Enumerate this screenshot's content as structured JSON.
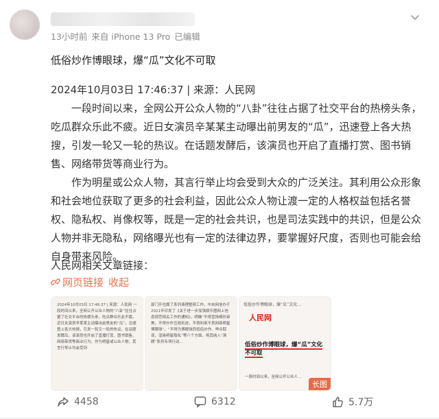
{
  "post": {
    "time": "13小时前",
    "source": "来自 iPhone 13 Pro",
    "edited": "已编辑",
    "title": "低俗炒作博眼球，爆“瓜”文化不可取",
    "date_line": "2024年10月03日 17:46:37 | 来源：人民网",
    "para1": "一段时间以来，全网公开公众人物的“八卦”往往占据了社交平台的热榜头条，吃瓜群众乐此不疲。近日女演员辛某某主动曝出前男友的“瓜”，迅速登上各大热搜，引发一轮又一轮的热议。在话题发酵后，该演员也开启了直播打赏、图书销售、网络带货等商业行为。",
    "para2": "作为明星或公众人物，其言行举止均会受到大众的广泛关注。其利用公众形象和社会地位获取了更多的社会利益，因此公众人物让渡一定的人格权益包括名誉权、隐私权、肖像权等，既是一定的社会共识，也是司法实践中的共识，但是公众人物并非无隐私，网络曝光也有一定的法律边界，要掌握好尺度，否则也可能会给自身带来风险。",
    "related": "人民网相关文章链接：",
    "link_label": "网页链接",
    "collapse_label": "收起"
  },
  "thumbs": {
    "t1_text": "2024年10月03日 17:46:37 | 来源：人民网 一段时间以来，全网公开公众人物的“八卦”往往占据了社交平台的热榜头条，吃瓜群众乐此不疲。近日女演员辛某某主动曝出前男友的“瓜”，迅速登上各大热搜，引发一轮又一轮的热议。在话题发酵后，该演员也开启了直播打赏、图书销售、网络带货等商业行为。作为明星或公众人物，其言行举止均会受到",
    "t2_text": "部门开也属了系列清理整顿工作。中央网信办于2021年印发了《关于进一步加强娱乐圈网上信息规范相关工作的通知》，明确“不得宣扬畸形审美，不得炒作丑闻劣迹，不得利用不良网络明星博眼球”，“不得为博眼球而低俗炒作、哗众取宠，渲染明星隐私”等八个方面，将其纳入“清朗”系列专项行动…",
    "t3_header": "低俗炒作博眼球，爆“瓜”文化…",
    "t3_logo": "人民网",
    "t3_title": "低俗炒作博眼球，爆“瓜”文化不可取",
    "t3_foot": "一段时间以来，全网公开公众人…",
    "long_badge": "长图"
  },
  "actions": {
    "share_count": "4458",
    "comment_count": "6312",
    "like_count": "5.7万"
  },
  "icons": [
    "more-icon",
    "link-icon",
    "share-icon",
    "comment-icon",
    "like-icon"
  ],
  "colors": {
    "link": "#eb7350",
    "meta": "#8a8a8a",
    "badge": "#e86b48"
  }
}
